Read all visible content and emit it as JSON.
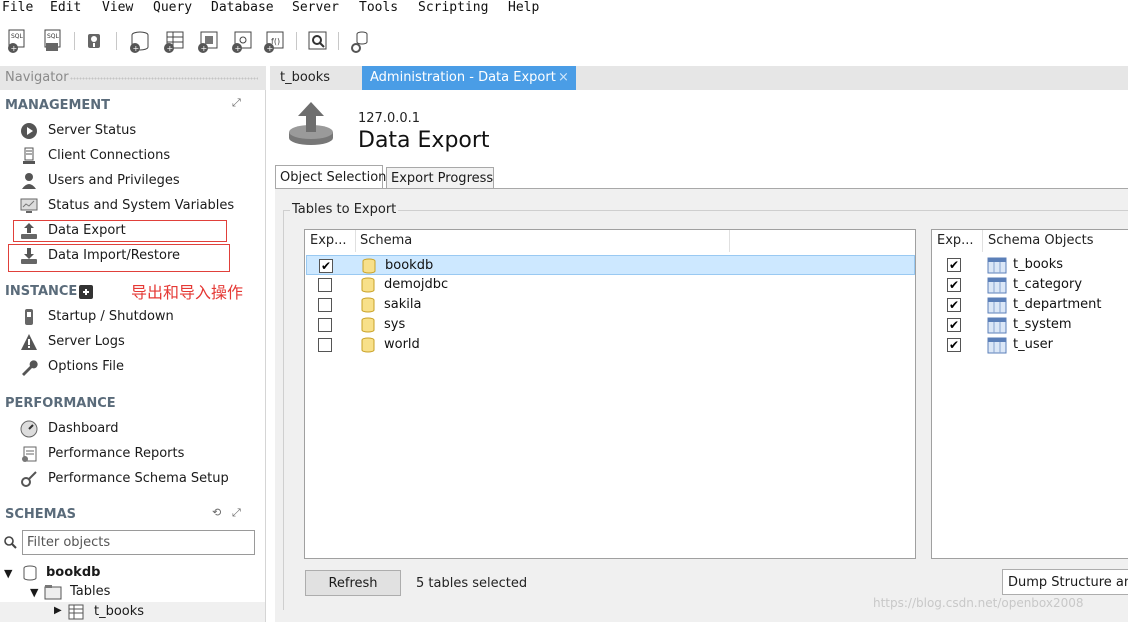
{
  "menu": [
    "File",
    "Edit",
    "View",
    "Query",
    "Database",
    "Server",
    "Tools",
    "Scripting",
    "Help"
  ],
  "toolbar": {
    "icons": [
      "new-sql-tab-icon",
      "open-sql-file-icon",
      "schema-inspector-icon",
      "create-schema-icon",
      "create-table-icon",
      "create-view-icon",
      "create-procedure-icon",
      "create-function-icon",
      "search-table-data-icon",
      "reconnect-icon"
    ]
  },
  "navigator": {
    "header": "Navigator",
    "management": {
      "title": "MANAGEMENT",
      "items": [
        {
          "label": "Server Status",
          "icon": "play-circle-icon"
        },
        {
          "label": "Client Connections",
          "icon": "server-icon"
        },
        {
          "label": "Users and Privileges",
          "icon": "user-icon"
        },
        {
          "label": "Status and System Variables",
          "icon": "monitor-icon"
        },
        {
          "label": "Data Export",
          "icon": "export-icon"
        },
        {
          "label": "Data Import/Restore",
          "icon": "import-icon"
        }
      ]
    },
    "annotation": "导出和导入操作",
    "instance": {
      "title": "INSTANCE",
      "items": [
        {
          "label": "Startup / Shutdown",
          "icon": "power-icon"
        },
        {
          "label": "Server Logs",
          "icon": "warning-icon"
        },
        {
          "label": "Options File",
          "icon": "wrench-icon"
        }
      ]
    },
    "performance": {
      "title": "PERFORMANCE",
      "items": [
        {
          "label": "Dashboard",
          "icon": "dashboard-icon"
        },
        {
          "label": "Performance Reports",
          "icon": "reports-icon"
        },
        {
          "label": "Performance Schema Setup",
          "icon": "setup-icon"
        }
      ]
    },
    "schemas": {
      "title": "SCHEMAS",
      "filter_placeholder": "Filter objects",
      "tree": {
        "db": "bookdb",
        "tables": "Tables",
        "table": "t_books"
      }
    }
  },
  "tabs": [
    {
      "label": "t_books",
      "active": false
    },
    {
      "label": "Administration - Data Export",
      "active": true,
      "close": "×"
    }
  ],
  "export": {
    "host": "127.0.0.1",
    "title": "Data Export",
    "subtabs": [
      "Object Selection",
      "Export Progress"
    ],
    "group_label": "Tables to Export",
    "schema_panel": {
      "col_export": "Exp...",
      "col_schema": "Schema",
      "rows": [
        {
          "name": "bookdb",
          "checked": true,
          "selected": true
        },
        {
          "name": "demojdbc",
          "checked": false,
          "selected": false
        },
        {
          "name": "sakila",
          "checked": false,
          "selected": false
        },
        {
          "name": "sys",
          "checked": false,
          "selected": false
        },
        {
          "name": "world",
          "checked": false,
          "selected": false
        }
      ]
    },
    "objects_panel": {
      "col_export": "Exp...",
      "col_objects": "Schema Objects",
      "rows": [
        {
          "name": "t_books",
          "checked": true
        },
        {
          "name": "t_category",
          "checked": true
        },
        {
          "name": "t_department",
          "checked": true
        },
        {
          "name": "t_system",
          "checked": true
        },
        {
          "name": "t_user",
          "checked": true
        }
      ]
    },
    "refresh_label": "Refresh",
    "status": "5 tables selected",
    "dump_option": "Dump Structure and"
  },
  "watermark": "https://blog.csdn.net/openbox2008",
  "colors": {
    "accent": "#4a9de6",
    "annotation": "#e53935",
    "selection": "#cde8ff"
  }
}
